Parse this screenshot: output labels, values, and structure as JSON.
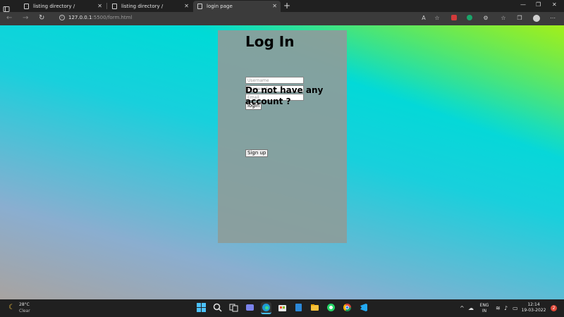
{
  "browser": {
    "tabs": [
      {
        "label": "listing directory /",
        "active": false
      },
      {
        "label": "listing directory /",
        "active": false
      },
      {
        "label": "login page",
        "active": true
      }
    ],
    "url_host": "127.0.0.1",
    "url_rest": ":5500/form.html"
  },
  "form": {
    "title": "Log In",
    "username_placeholder": "Username",
    "password_placeholder": "password",
    "email_placeholder": "Email",
    "login_label": "login",
    "no_account_text": "Do not have any account ?",
    "signup_label": "Sign up"
  },
  "taskbar": {
    "weather_temp": "28°C",
    "weather_condition": "Clear",
    "language_line1": "ENG",
    "language_line2": "IN",
    "time": "12:14",
    "date": "19-03-2022",
    "notification_count": "2"
  },
  "colors": {
    "panel": "#8c9d9b",
    "gradient_cyan": "#00dad7",
    "gradient_green": "#aaf014",
    "chrome_dark": "#202020"
  }
}
